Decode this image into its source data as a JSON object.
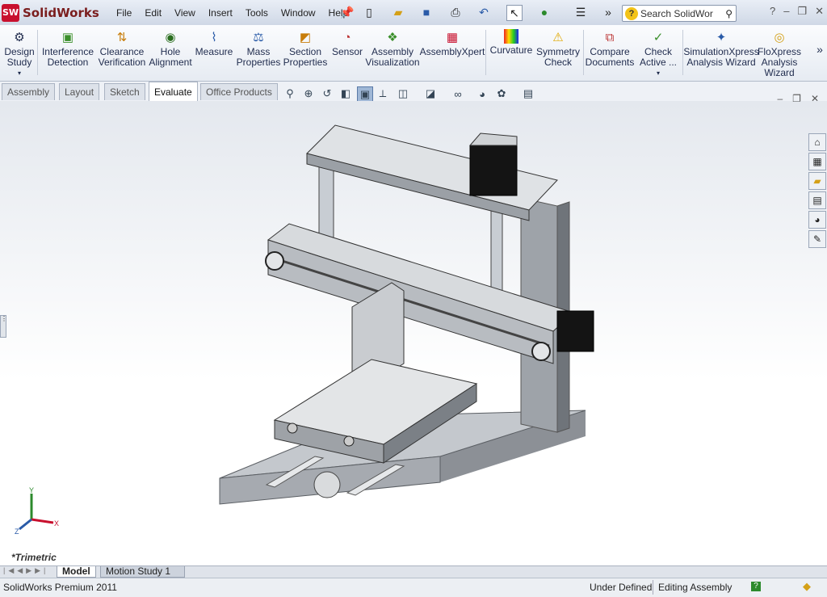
{
  "app": {
    "logo_text": "SolidWorks",
    "logo_badge": "SW"
  },
  "menu": [
    "File",
    "Edit",
    "View",
    "Insert",
    "Tools",
    "Window",
    "Help"
  ],
  "search": {
    "placeholder": "Search SolidWor"
  },
  "commands": [
    {
      "label1": "Design",
      "label2": "Study",
      "icon": "design-study-icon"
    },
    {
      "label1": "Interference",
      "label2": "Detection",
      "icon": "interference-icon"
    },
    {
      "label1": "Clearance",
      "label2": "Verification",
      "icon": "clearance-icon"
    },
    {
      "label1": "Hole",
      "label2": "Alignment",
      "icon": "hole-alignment-icon"
    },
    {
      "label1": "Measure",
      "label2": "",
      "icon": "measure-icon"
    },
    {
      "label1": "Mass",
      "label2": "Properties",
      "icon": "mass-properties-icon"
    },
    {
      "label1": "Section",
      "label2": "Properties",
      "icon": "section-properties-icon"
    },
    {
      "label1": "Sensor",
      "label2": "",
      "icon": "sensor-icon"
    },
    {
      "label1": "Assembly",
      "label2": "Visualization",
      "icon": "assembly-visualization-icon"
    },
    {
      "label1": "AssemblyXpert",
      "label2": "",
      "icon": "assemblyxpert-icon"
    },
    {
      "label1": "Curvature",
      "label2": "",
      "icon": "curvature-icon"
    },
    {
      "label1": "Symmetry",
      "label2": "Check",
      "icon": "symmetry-check-icon"
    },
    {
      "label1": "Compare",
      "label2": "Documents",
      "icon": "compare-documents-icon"
    },
    {
      "label1": "Check",
      "label2": "Active ...",
      "icon": "check-active-icon"
    },
    {
      "label1": "SimulationXpress",
      "label2": "Analysis Wizard",
      "icon": "simulationxpress-icon"
    },
    {
      "label1": "FloXpress",
      "label2": "Analysis",
      "label3": "Wizard",
      "icon": "floxpress-icon"
    }
  ],
  "tabs": [
    {
      "label": "Assembly",
      "active": false
    },
    {
      "label": "Layout",
      "active": false
    },
    {
      "label": "Sketch",
      "active": false
    },
    {
      "label": "Evaluate",
      "active": true
    },
    {
      "label": "Office Products",
      "active": false
    }
  ],
  "viewport": {
    "view_name": "*Trimetric",
    "triad": {
      "x": "X",
      "y": "Y",
      "z": "Z"
    }
  },
  "bottom_tabs": [
    "Model",
    "Motion Study 1"
  ],
  "status": {
    "product": "SolidWorks Premium 2011",
    "definition": "Under Defined",
    "mode": "Editing Assembly",
    "help": "?"
  },
  "colors": {
    "accent": "#c8102e",
    "model_gray": "#b9bec4",
    "frame_dark": "#5c6168"
  }
}
